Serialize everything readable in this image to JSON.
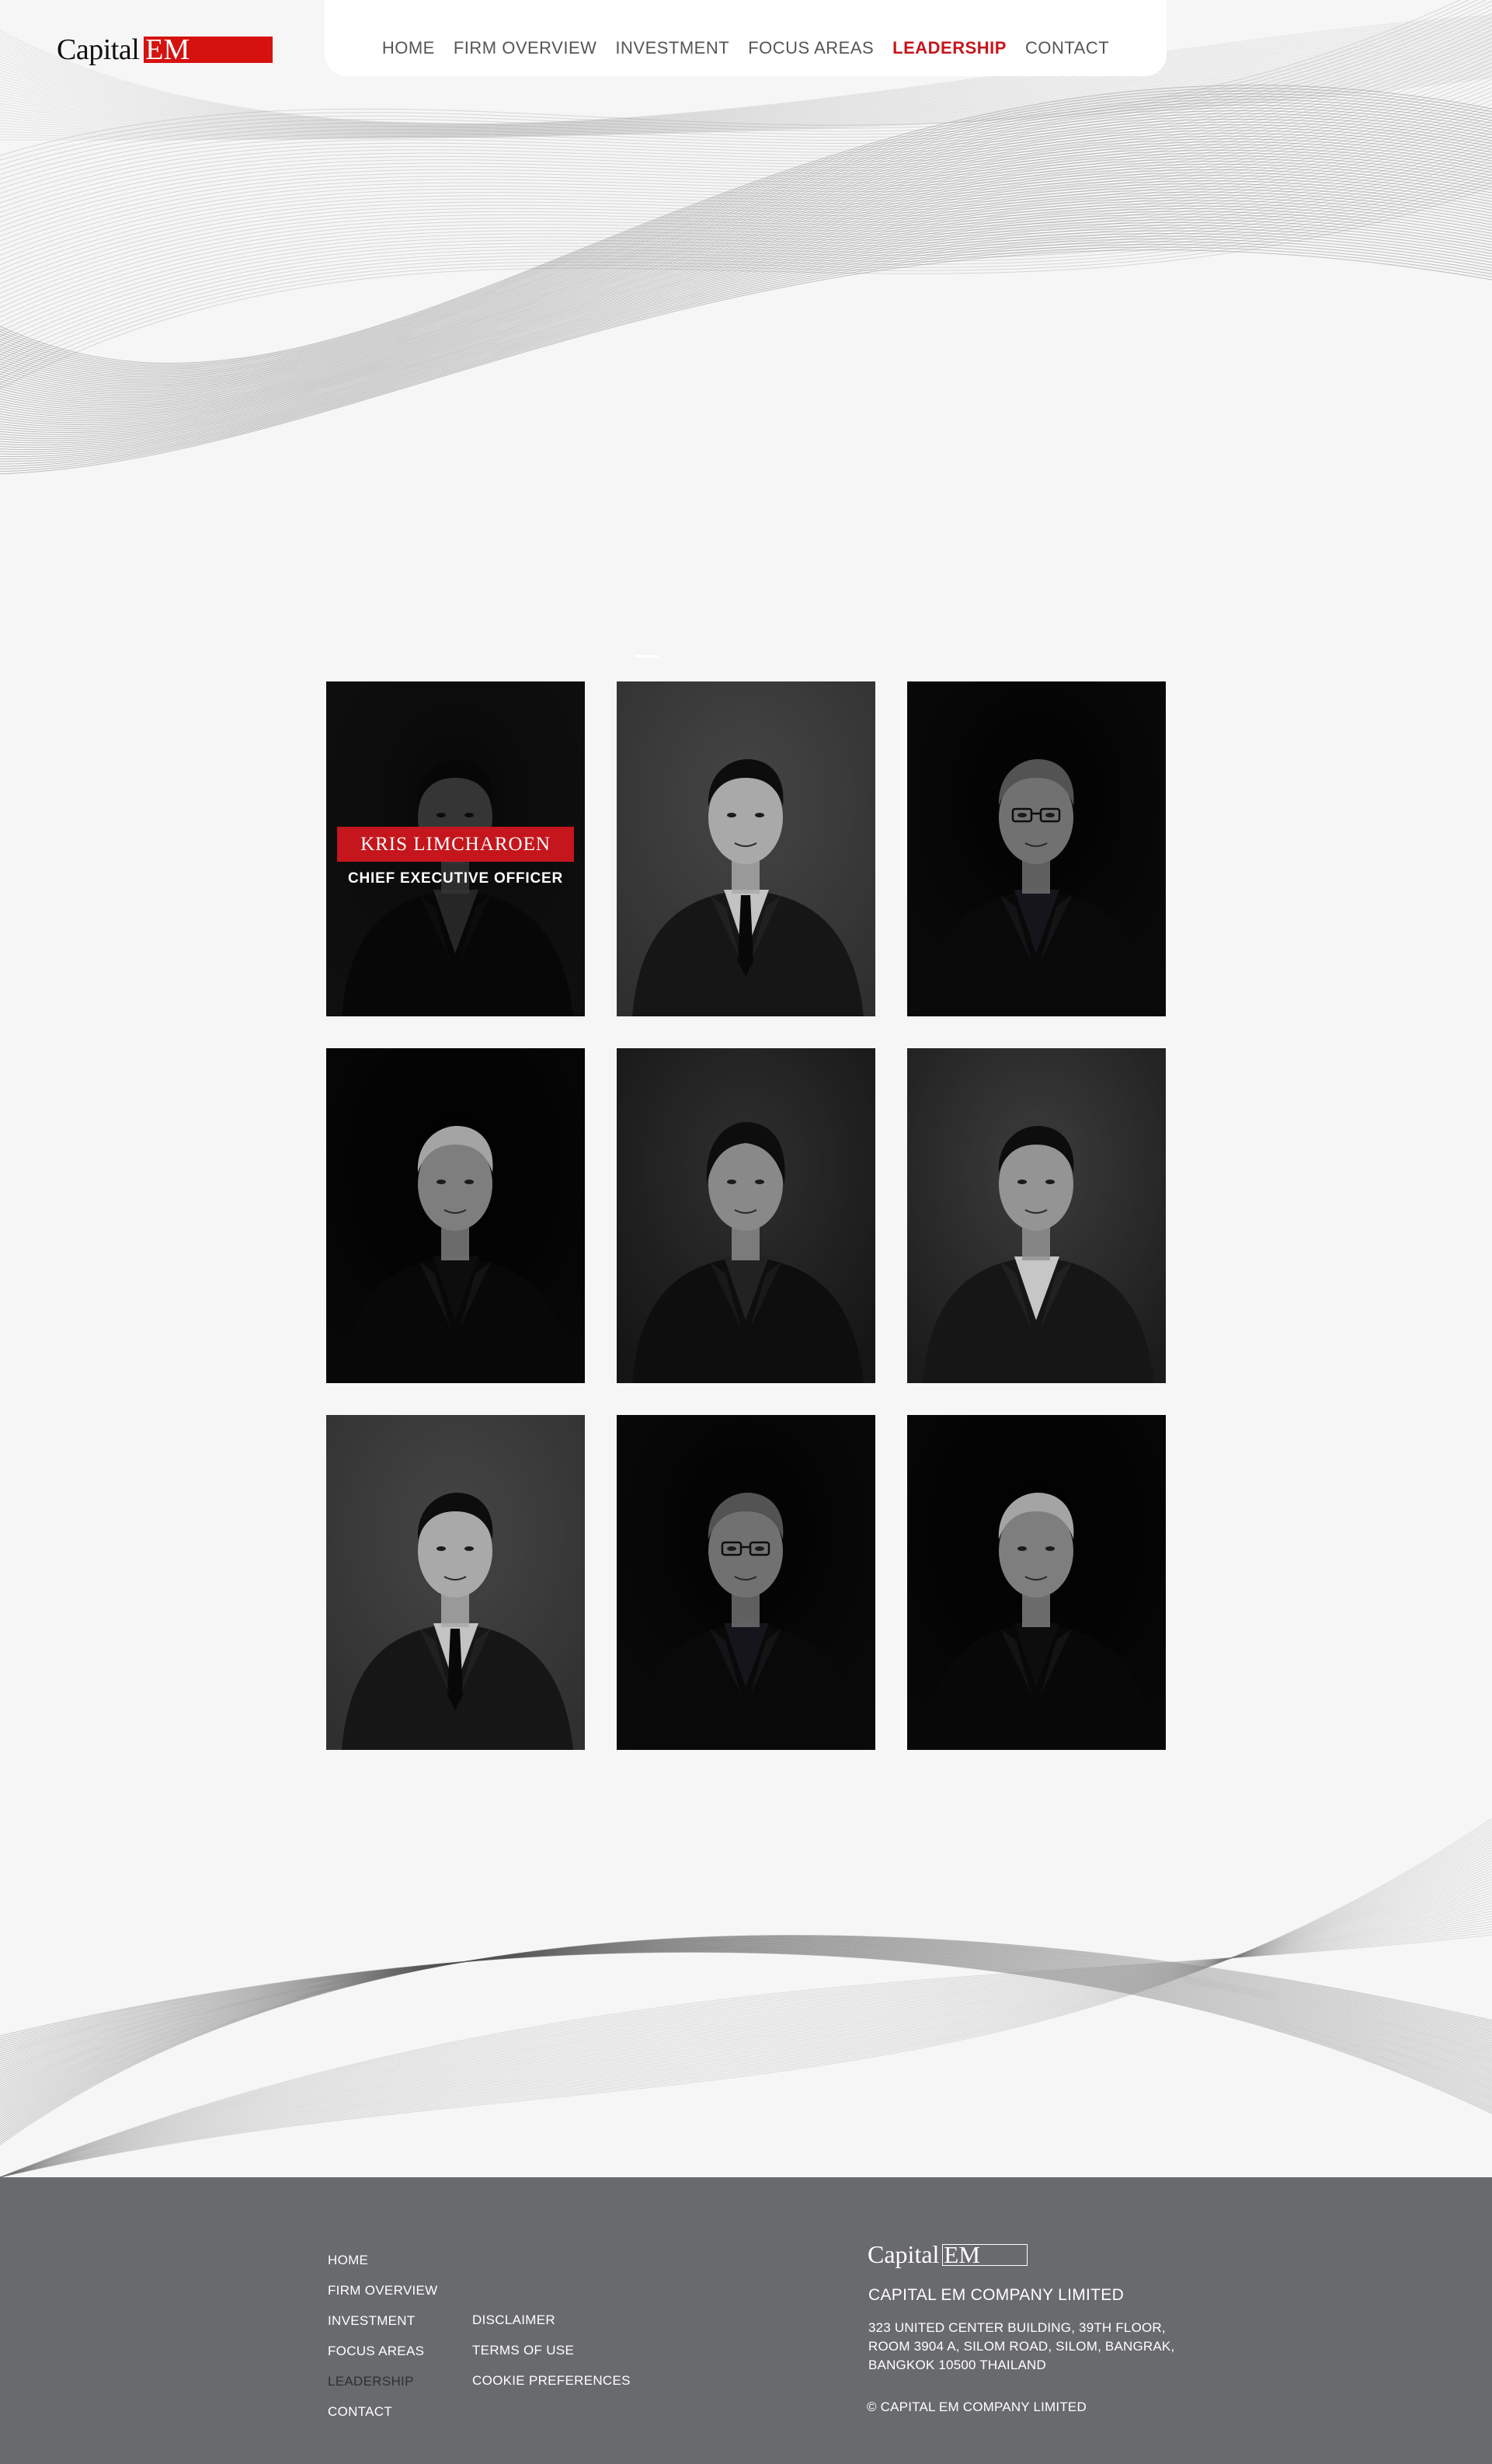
{
  "brand": {
    "logo_word": "Capital",
    "logo_em": "EM",
    "brand_red": "#d6120f",
    "accent_red": "#c4161c"
  },
  "nav": {
    "items": [
      "HOME",
      "FIRM OVERVIEW",
      "INVESTMENT",
      "FOCUS AREAS",
      "LEADERSHIP",
      "CONTACT"
    ],
    "active": "LEADERSHIP"
  },
  "leaders": [
    {
      "name": "KRIS LIMCHAROEN",
      "title": "CHIEF EXECUTIVE OFFICER",
      "hover": true,
      "portrait": "young-man-beard-dark-suit"
    },
    {
      "portrait": "smiling-man-suit-arms-crossed"
    },
    {
      "portrait": "older-man-glasses-dark"
    },
    {
      "portrait": "grey-haired-man-dark"
    },
    {
      "portrait": "woman-dark-blazer-arms-crossed"
    },
    {
      "portrait": "man-white-shirt-dark-blazer"
    },
    {
      "portrait": "smiling-man-suit-arms-crossed"
    },
    {
      "portrait": "older-man-glasses-dark"
    },
    {
      "portrait": "grey-haired-man-dark"
    }
  ],
  "footer": {
    "nav": [
      "HOME",
      "FIRM OVERVIEW",
      "INVESTMENT",
      "FOCUS AREAS",
      "LEADERSHIP",
      "CONTACT"
    ],
    "current": "LEADERSHIP",
    "legal": [
      "DISCLAIMER",
      "TERMS OF USE",
      "COOKIE PREFERENCES"
    ],
    "company": "CAPITAL EM COMPANY LIMITED",
    "address": [
      "323 UNITED CENTER BUILDING, 39TH FLOOR,",
      "ROOM 3904 A, SILOM ROAD, SILOM, BANGRAK,",
      "BANGKOK 10500 THAILAND"
    ],
    "copyright": "© CAPITAL EM COMPANY LIMITED"
  }
}
